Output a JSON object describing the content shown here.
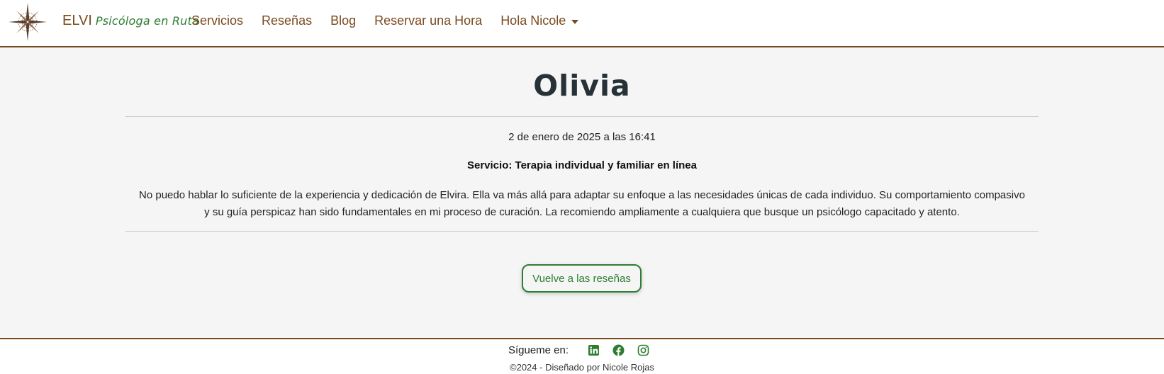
{
  "navbar": {
    "brand_name": "ELVI",
    "brand_subtitle": "Psicóloga en Ruta",
    "logo_icon": "compass-rose-icon",
    "links": [
      {
        "label": "Servicios"
      },
      {
        "label": "Reseñas"
      },
      {
        "label": "Blog"
      },
      {
        "label": "Reservar una Hora"
      },
      {
        "label": "Hola Nicole",
        "dropdown": true
      }
    ]
  },
  "review": {
    "author": "Olivia",
    "date": "2 de enero de 2025 a las 16:41",
    "service": "Servicio: Terapia individual y familiar en línea",
    "body": "No puedo hablar lo suficiente de la experiencia y dedicación de Elvira. Ella va más allá para adaptar su enfoque a las necesidades únicas de cada individuo. Su comportamiento compasivo y su guía perspicaz han sido fundamentales en mi proceso de curación. La recomiendo ampliamente a cualquiera que busque un psicólogo capacitado y atento.",
    "back_button": "Vuelve a las reseñas"
  },
  "footer": {
    "follow_label": "Sígueme en:",
    "social": [
      "linkedin-icon",
      "facebook-icon",
      "instagram-icon"
    ],
    "copyright": "©2024 - Diseñado por Nicole Rojas"
  },
  "colors": {
    "brand_brown": "#7a4a1f",
    "accent_green": "#2e7d32",
    "background": "#f5f5f5"
  }
}
